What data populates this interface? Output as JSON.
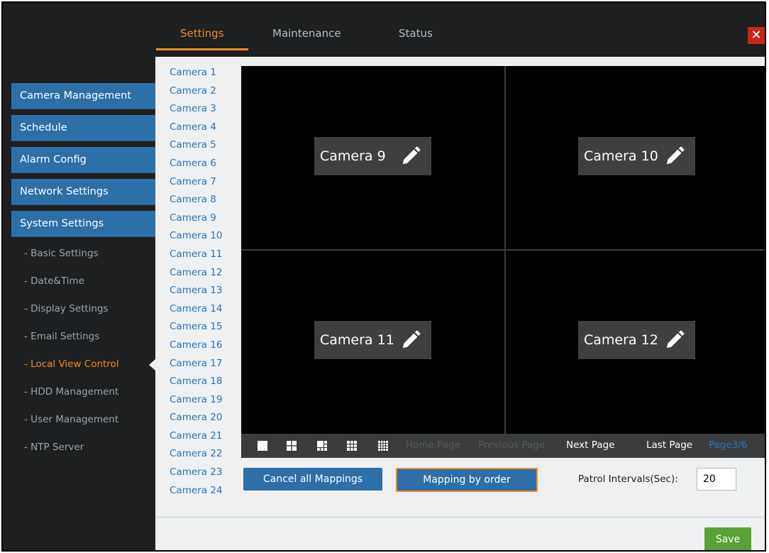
{
  "header": {
    "tabs": [
      {
        "label": "Settings",
        "active": true
      },
      {
        "label": "Maintenance",
        "active": false
      },
      {
        "label": "Status",
        "active": false
      }
    ],
    "close_label": "✕"
  },
  "sidebar": {
    "sections": [
      {
        "label": "Camera Management"
      },
      {
        "label": "Schedule"
      },
      {
        "label": "Alarm Config"
      },
      {
        "label": "Network Settings"
      },
      {
        "label": "System Settings"
      }
    ],
    "sub_items": [
      {
        "label": "- Basic Settings",
        "active": false
      },
      {
        "label": "- Date&Time",
        "active": false
      },
      {
        "label": "- Display Settings",
        "active": false
      },
      {
        "label": "- Email Settings",
        "active": false
      },
      {
        "label": "- Local View Control",
        "active": true
      },
      {
        "label": "- HDD Management",
        "active": false
      },
      {
        "label": "- User Management",
        "active": false
      },
      {
        "label": "- NTP Server",
        "active": false
      }
    ]
  },
  "camera_list": [
    "Camera 1",
    "Camera 2",
    "Camera 3",
    "Camera 4",
    "Camera 5",
    "Camera 6",
    "Camera 7",
    "Camera 8",
    "Camera 9",
    "Camera 10",
    "Camera 11",
    "Camera 12",
    "Camera 13",
    "Camera 14",
    "Camera 15",
    "Camera 16",
    "Camera 17",
    "Camera 18",
    "Camera 19",
    "Camera 20",
    "Camera 21",
    "Camera 22",
    "Camera 23",
    "Camera 24"
  ],
  "grid": {
    "cells": [
      {
        "label": "Camera 9"
      },
      {
        "label": "Camera 10"
      },
      {
        "label": "Camera 11"
      },
      {
        "label": "Camera 12"
      }
    ]
  },
  "toolbar": {
    "layout_icons": [
      "layout-1-icon",
      "layout-4-icon",
      "layout-6-icon",
      "layout-9-icon",
      "layout-16-icon"
    ],
    "home_page": "Home Page",
    "previous_page": "Previous Page",
    "next_page": "Next Page",
    "last_page": "Last Page",
    "page_indicator": "Page3/6"
  },
  "actions": {
    "cancel_label": "Cancel all Mappings",
    "mapping_label": "Mapping by order",
    "patrol_label": "Patrol Intervals(Sec):",
    "patrol_value": "20",
    "save_label": "Save"
  },
  "colors": {
    "accent_orange": "#f08a24",
    "primary_blue": "#2d6fa8",
    "save_green": "#58a238",
    "close_red": "#c8241e"
  }
}
